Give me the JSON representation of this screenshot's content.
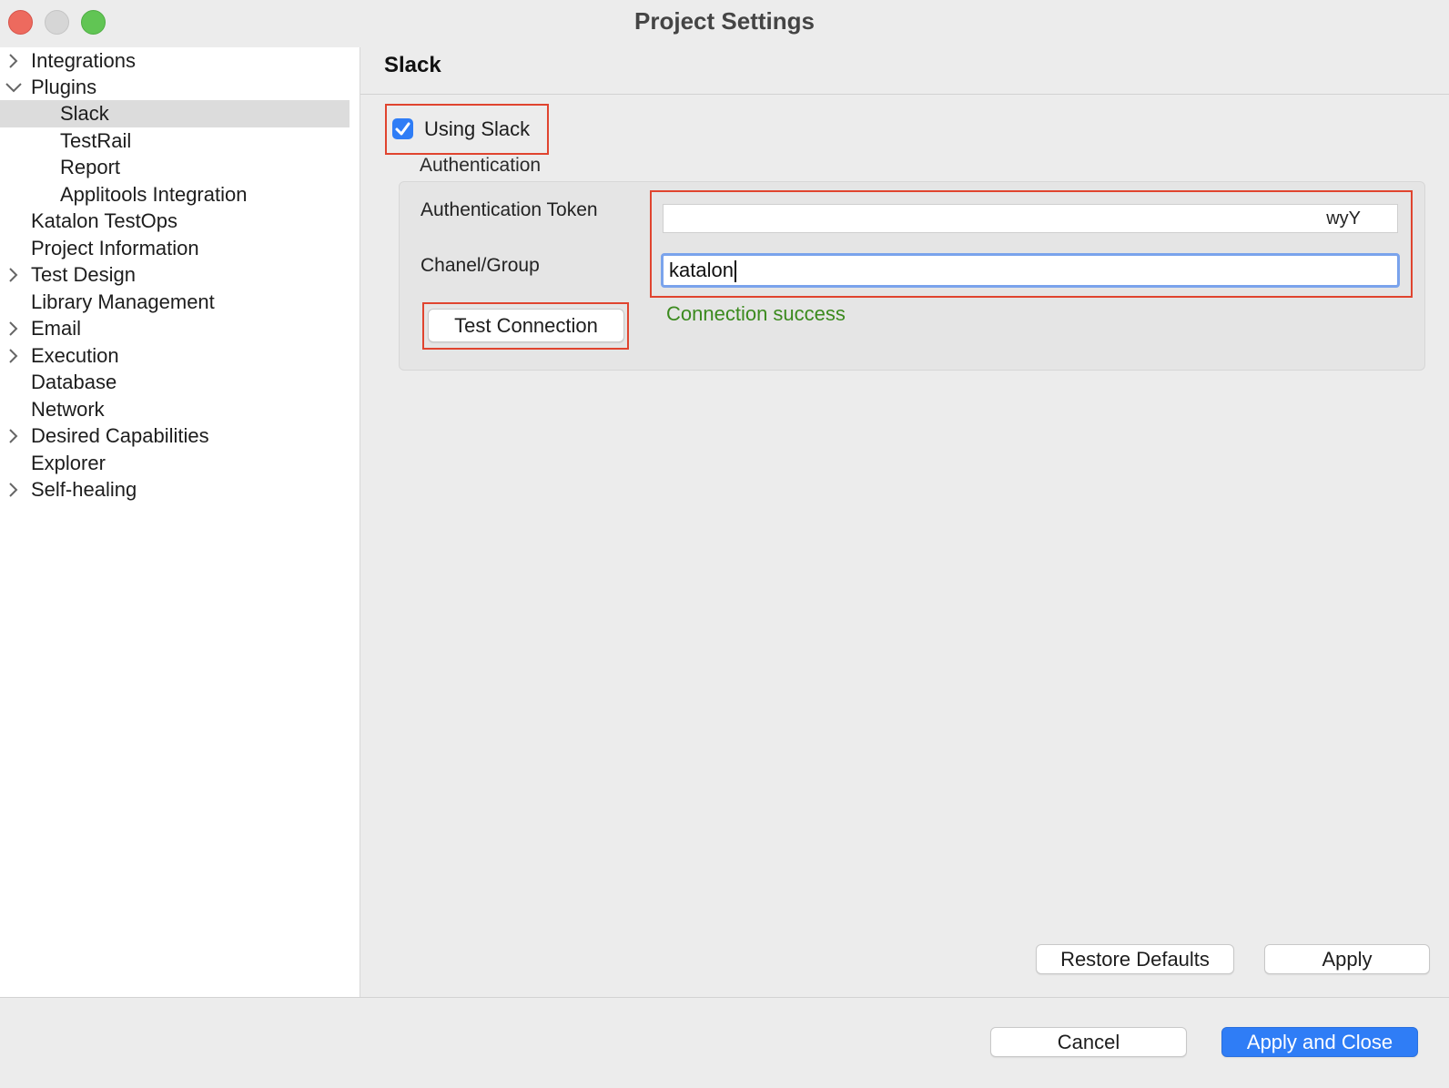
{
  "window": {
    "title": "Project Settings"
  },
  "sidebar": {
    "items": [
      {
        "label": "Integrations",
        "expander": "collapsed"
      },
      {
        "label": "Plugins",
        "expander": "expanded"
      },
      {
        "label": "Slack",
        "selected": true
      },
      {
        "label": "TestRail"
      },
      {
        "label": "Report"
      },
      {
        "label": "Applitools Integration"
      },
      {
        "label": "Katalon TestOps"
      },
      {
        "label": "Project Information"
      },
      {
        "label": "Test Design",
        "expander": "collapsed"
      },
      {
        "label": "Library Management"
      },
      {
        "label": "Email",
        "expander": "collapsed"
      },
      {
        "label": "Execution",
        "expander": "collapsed"
      },
      {
        "label": "Database"
      },
      {
        "label": "Network"
      },
      {
        "label": "Desired Capabilities",
        "expander": "collapsed"
      },
      {
        "label": "Explorer"
      },
      {
        "label": "Self-healing",
        "expander": "collapsed"
      }
    ]
  },
  "main": {
    "title": "Slack",
    "using_slack": {
      "label": "Using Slack",
      "checked": true
    },
    "group_label": "Authentication",
    "token": {
      "label": "Authentication Token",
      "value": "wyY"
    },
    "channel": {
      "label": "Chanel/Group",
      "value": "katalon"
    },
    "test_button": "Test Connection",
    "status": "Connection success",
    "restore_button": "Restore Defaults",
    "apply_button": "Apply"
  },
  "footer": {
    "cancel_button": "Cancel",
    "apply_close_button": "Apply and Close"
  },
  "colors": {
    "accent": "#2f7df6",
    "highlight_box": "#e0442f",
    "success": "#3b8a1e"
  }
}
